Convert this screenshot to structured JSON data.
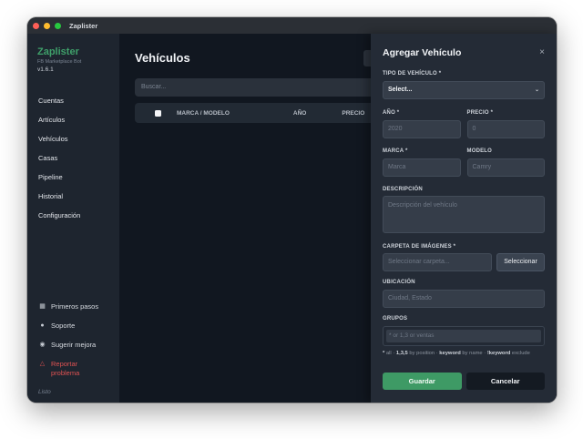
{
  "window": {
    "title": "Zaplister"
  },
  "brand": {
    "name": "Zaplister",
    "subtitle": "FB Marketplace Bot",
    "version": "v1.6.1"
  },
  "sidebar": {
    "items": [
      {
        "label": "Cuentas"
      },
      {
        "label": "Artículos"
      },
      {
        "label": "Vehículos"
      },
      {
        "label": "Casas"
      },
      {
        "label": "Pipeline"
      },
      {
        "label": "Historial"
      },
      {
        "label": "Configuración"
      }
    ],
    "bottom": [
      {
        "label": "Primeros pasos",
        "icon": "book-icon"
      },
      {
        "label": "Soporte",
        "icon": "chat-bubble-icon"
      },
      {
        "label": "Sugerir mejora",
        "icon": "lightbulb-icon"
      },
      {
        "label": "Reportar problema",
        "icon": "warning-icon"
      }
    ],
    "status": "Listo"
  },
  "main": {
    "title": "Vehículos",
    "search_placeholder": "Buscar...",
    "columns": [
      "MARCA / MODELO",
      "AÑO",
      "PRECIO"
    ]
  },
  "panel": {
    "title": "Agregar Vehículo",
    "close_label": "×",
    "tipo_label": "TIPO DE VEHÍCULO *",
    "tipo_value": "Select...",
    "anio_label": "AÑO *",
    "anio_placeholder": "2020",
    "precio_label": "PRECIO *",
    "precio_placeholder": "0",
    "marca_label": "MARCA *",
    "marca_placeholder": "Marca",
    "modelo_label": "MODELO",
    "modelo_placeholder": "Camry",
    "desc_label": "DESCRIPCIÓN",
    "desc_placeholder": "Descripción del vehículo",
    "carpeta_label": "CARPETA DE IMÁGENES *",
    "carpeta_placeholder": "Seleccionar carpeta...",
    "carpeta_button": "Seleccionar",
    "ubicacion_label": "UBICACIÓN",
    "ubicacion_placeholder": "Ciudad, Estado",
    "grupos_label": "GRUPOS",
    "grupos_placeholder": "* or 1,3 or ventas",
    "hint": {
      "all_key": "*",
      "all_text": "all",
      "pos_key": "1,3,5",
      "pos_text": "by position",
      "name_key": "keyword",
      "name_text": "by name",
      "excl_key": "!keyword",
      "excl_text": "exclude"
    },
    "save_button": "Guardar",
    "cancel_button": "Cancelar"
  },
  "colors": {
    "accent": "#3e9a65",
    "danger": "#e05252",
    "brand": "#3fa06a"
  }
}
